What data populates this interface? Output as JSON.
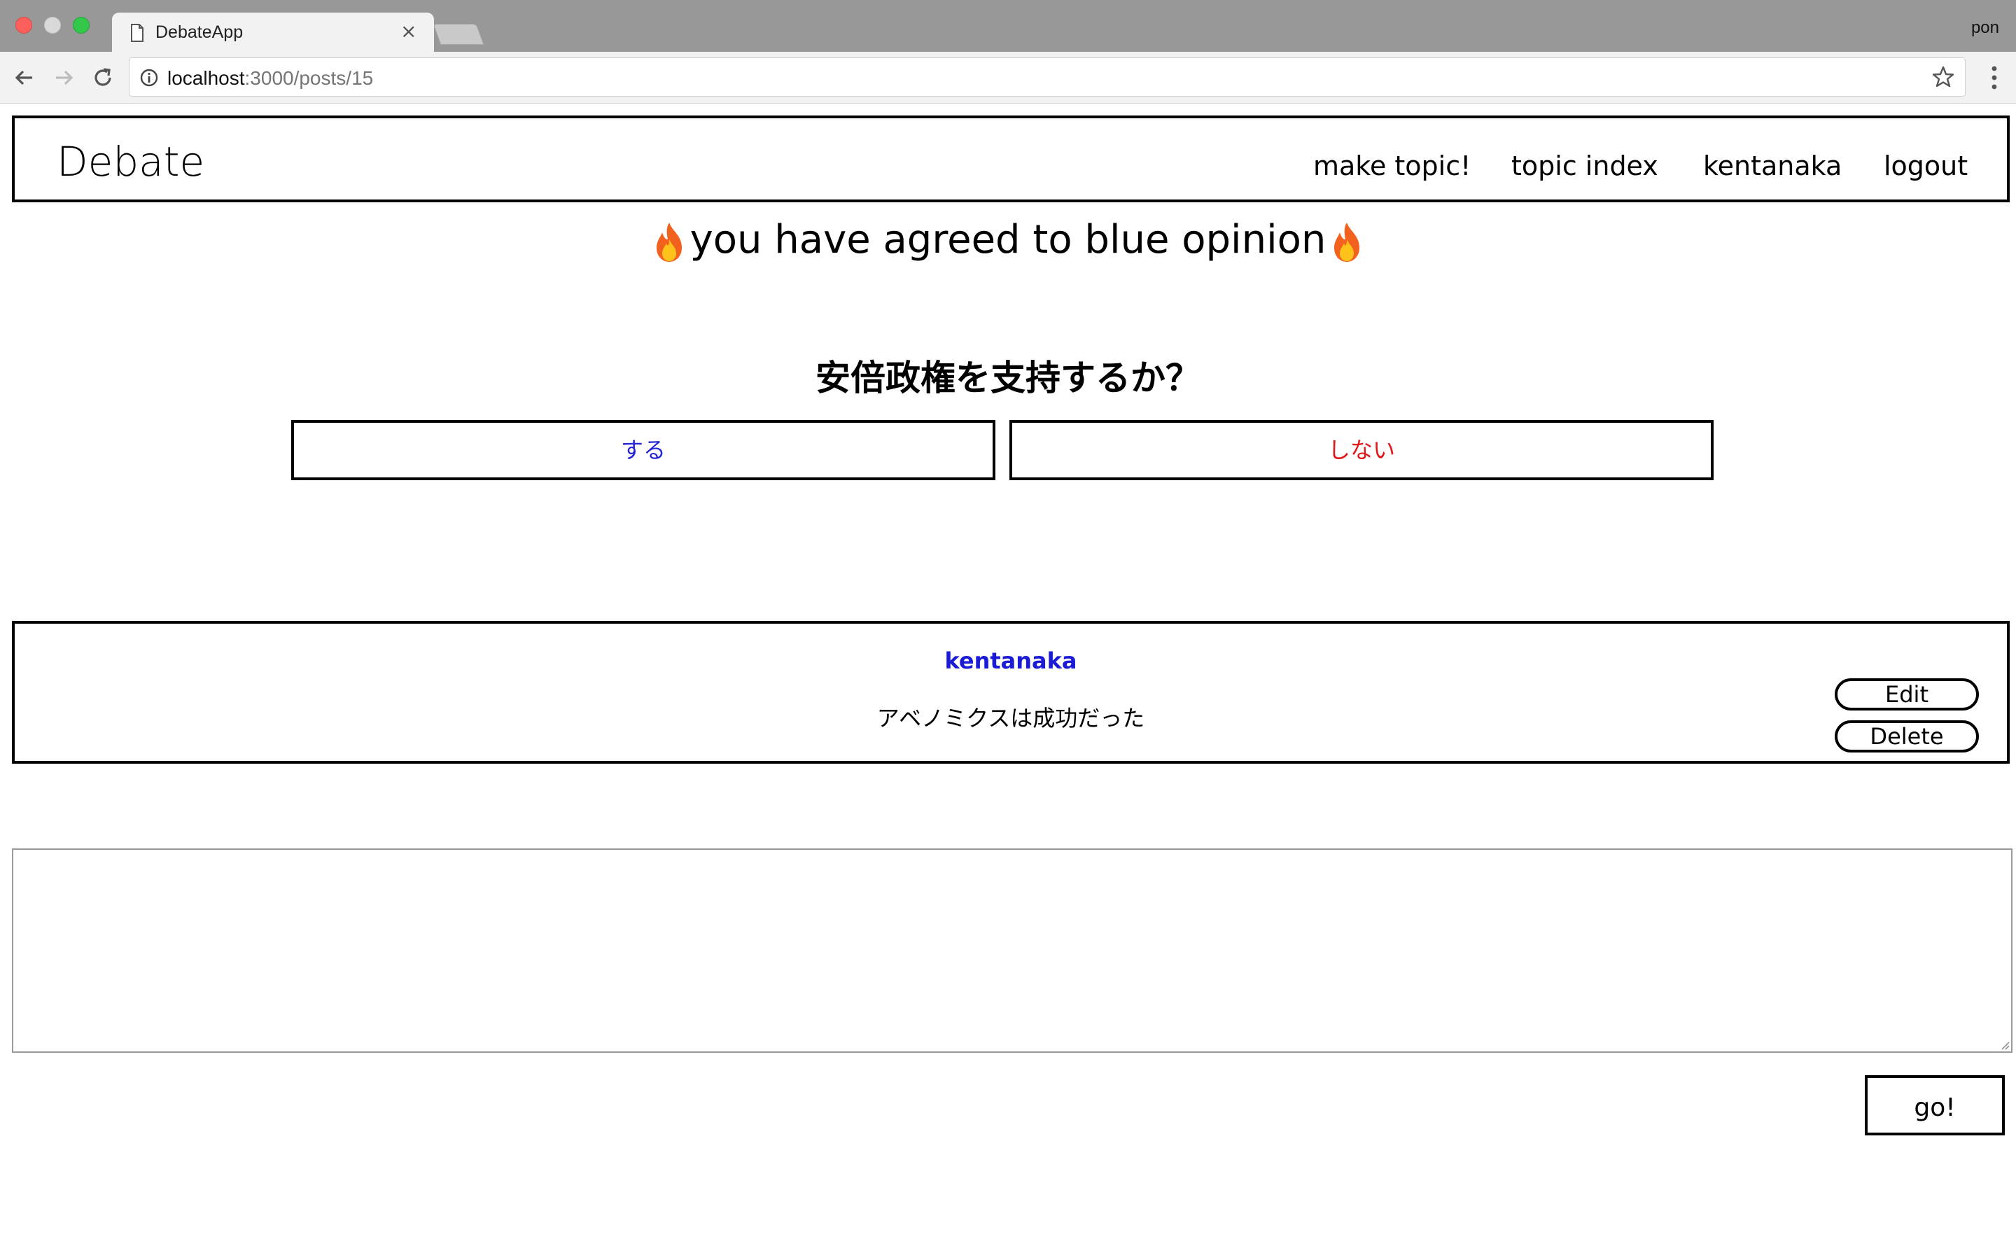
{
  "browser": {
    "tab_title": "DebateApp",
    "tab_close": "×",
    "profile_name": "pon",
    "url_host": "localhost",
    "url_path": ":3000/posts/15"
  },
  "header": {
    "brand": "Debate",
    "nav": {
      "make_topic": "make topic!",
      "topic_index": "topic index",
      "user": "kentanaka",
      "logout": "logout"
    }
  },
  "notice": {
    "text": "you have agreed to blue opinion"
  },
  "topic": {
    "question": "安倍政権を支持するか？",
    "yes_label": "する",
    "no_label": "しない",
    "yes_color": "#2424d8",
    "no_color": "#e11717"
  },
  "comments": [
    {
      "user": "kentanaka",
      "body": "アベノミクスは成功だった",
      "edit_label": "Edit",
      "delete_label": "Delete"
    }
  ],
  "reply": {
    "value": "",
    "submit_label": "go!"
  }
}
